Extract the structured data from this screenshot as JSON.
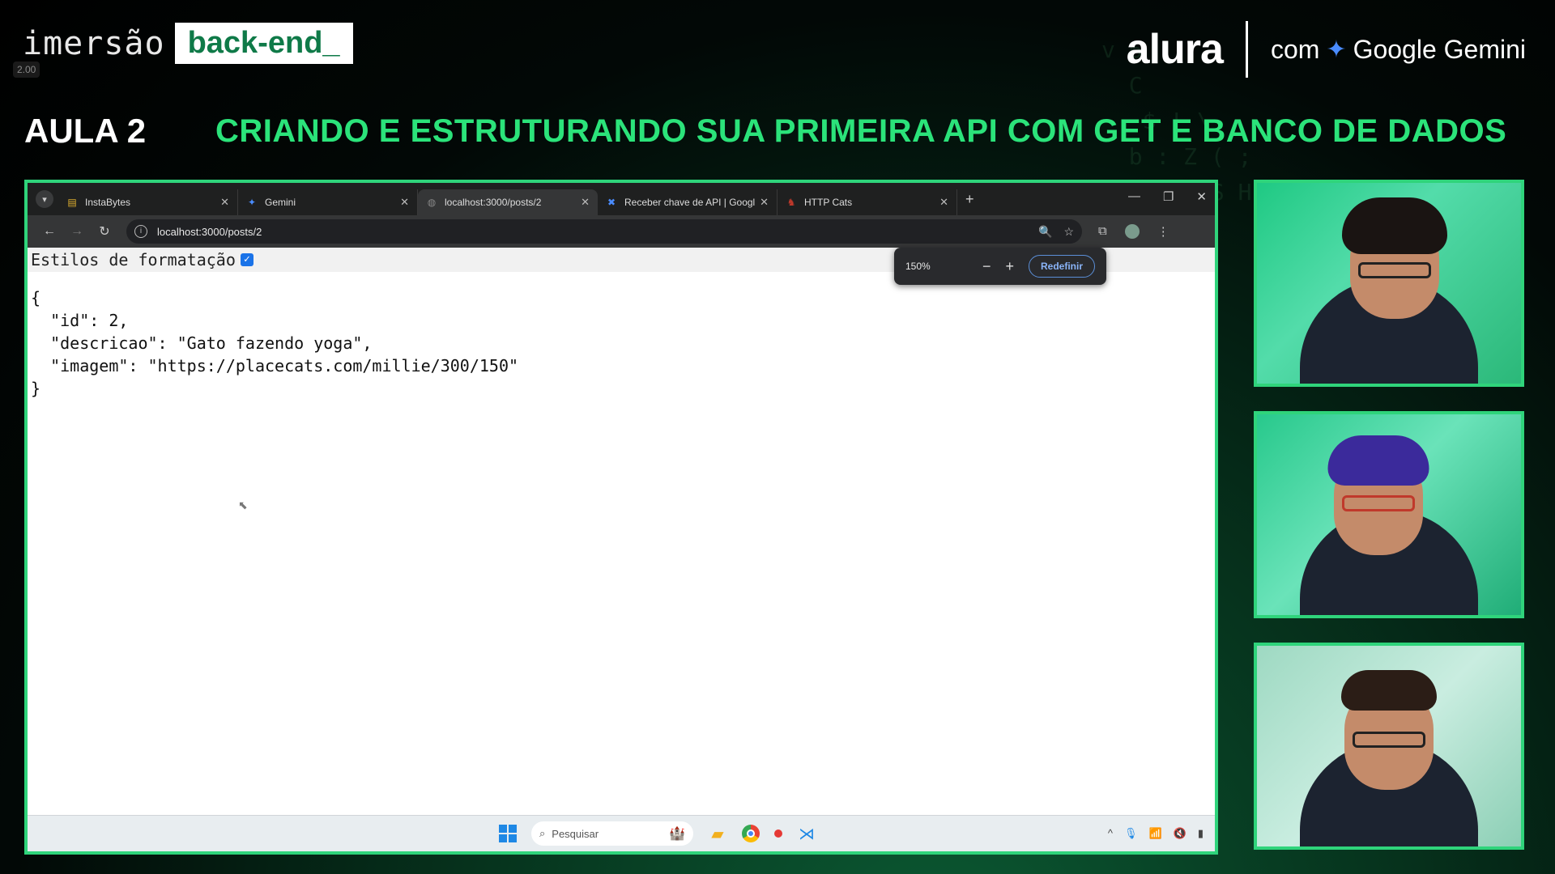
{
  "header": {
    "brand_light": "imersão",
    "brand_bold": "back-end_",
    "speed": "2.00",
    "partner_logo": "alura",
    "partner_text": "com",
    "partner_name": "Google Gemini",
    "lesson": "AULA 2",
    "lesson_title": "CRIANDO E ESTRUTURANDO SUA PRIMEIRA API COM GET E BANCO DE DADOS"
  },
  "browser": {
    "tabs": [
      {
        "label": "InstaBytes",
        "icon": "instabytes-icon"
      },
      {
        "label": "Gemini",
        "icon": "gemini-icon"
      },
      {
        "label": "localhost:3000/posts/2",
        "icon": "globe-icon",
        "active": true
      },
      {
        "label": "Receber chave de API | Google",
        "icon": "google-ai-icon"
      },
      {
        "label": "HTTP Cats",
        "icon": "httpcats-icon"
      }
    ],
    "url": "localhost:3000/posts/2",
    "zoom": {
      "value": "150%",
      "reset_label": "Redefinir"
    },
    "formatting_label": "Estilos de formatação",
    "formatting_checked": true,
    "json_lines": [
      "{",
      "  \"id\": 2,",
      "  \"descricao\": \"Gato fazendo yoga\",",
      "  \"imagem\": \"https://placecats.com/millie/300/150\"",
      "}"
    ]
  },
  "taskbar": {
    "search_placeholder": "Pesquisar"
  },
  "colors": {
    "accent_green": "#2fd47b",
    "title_green": "#2be37a",
    "checkbox_blue": "#1a73e8"
  }
}
